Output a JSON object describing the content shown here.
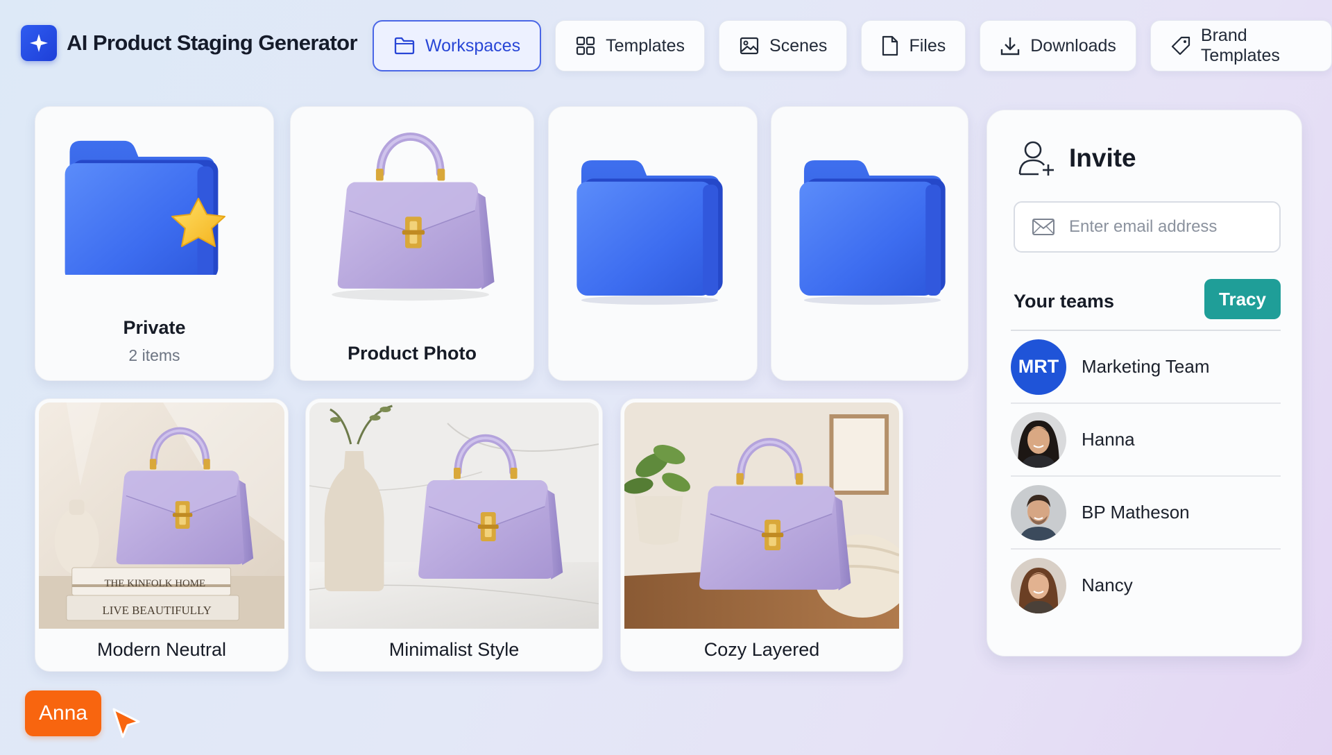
{
  "app": {
    "title": "AI Product Staging Generator"
  },
  "nav": [
    {
      "label": "Workspaces",
      "icon": "folder-icon",
      "active": true
    },
    {
      "label": "Templates",
      "icon": "grid-icon",
      "active": false
    },
    {
      "label": "Scenes",
      "icon": "image-icon",
      "active": false
    },
    {
      "label": "Files",
      "icon": "file-icon",
      "active": false
    },
    {
      "label": "Downloads",
      "icon": "download-icon",
      "active": false
    },
    {
      "label": "Brand Templates",
      "icon": "tag-icon",
      "active": false
    }
  ],
  "folders": [
    {
      "title": "Private",
      "subtitle": "2 items",
      "icon": "starred-folder-icon"
    },
    {
      "title": "Product Photo",
      "icon": "handbag-icon"
    },
    {
      "title": "",
      "icon": "folder-icon"
    },
    {
      "title": "",
      "icon": "folder-icon"
    }
  ],
  "scenes": [
    {
      "title": "Modern Neutral"
    },
    {
      "title": "Minimalist Style"
    },
    {
      "title": "Cozy Layered"
    }
  ],
  "scene_book_texts": {
    "top": "THE KINFOLK HOME",
    "bottom": "LIVE BEAUTIFULLY"
  },
  "invite": {
    "title": "Invite",
    "email_placeholder": "Enter email address",
    "teams_label": "Your teams",
    "current_user_button": "Tracy",
    "teams": [
      {
        "name": "Marketing Team",
        "initials": "MRT"
      },
      {
        "name": "Hanna"
      },
      {
        "name": "BP Matheson"
      },
      {
        "name": "Nancy"
      }
    ]
  },
  "cursor": {
    "label": "Anna",
    "color": "#f8650f"
  },
  "colors": {
    "accent": "#2846d6",
    "folder": "#3a6cf0",
    "teal": "#1f9e98",
    "bag": "#b8a8dc"
  }
}
